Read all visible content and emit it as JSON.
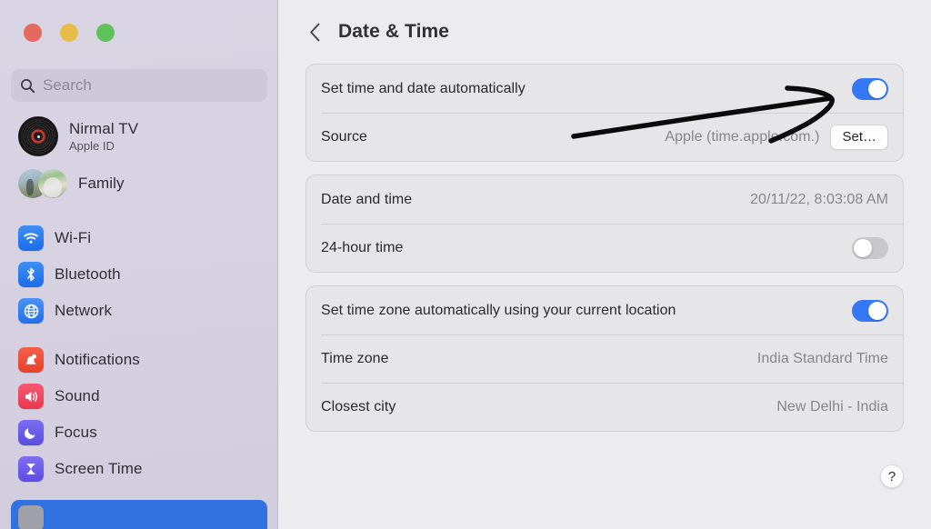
{
  "window": {
    "traffic_lights": [
      "close",
      "minimize",
      "maximize"
    ]
  },
  "sidebar": {
    "search": {
      "placeholder": "Search",
      "value": "",
      "icon": "search-icon"
    },
    "account": {
      "name": "Nirmal TV",
      "subtitle": "Apple ID",
      "avatar": "vinyl-record-avatar"
    },
    "family": {
      "label": "Family",
      "avatar": "family-photo-avatars"
    },
    "groups": [
      {
        "items": [
          {
            "label": "Wi-Fi",
            "icon": "wifi-icon",
            "color": "#2b7cf0"
          },
          {
            "label": "Bluetooth",
            "icon": "bluetooth-icon",
            "color": "#2b7cf0"
          },
          {
            "label": "Network",
            "icon": "globe-icon",
            "color": "#2b7cf0"
          }
        ]
      },
      {
        "items": [
          {
            "label": "Notifications",
            "icon": "bell-icon",
            "color": "#e8412c"
          },
          {
            "label": "Sound",
            "icon": "speaker-icon",
            "color": "#e8374f"
          },
          {
            "label": "Focus",
            "icon": "moon-icon",
            "color": "#5a4be0"
          },
          {
            "label": "Screen Time",
            "icon": "hourglass-icon",
            "color": "#5d4ce2"
          }
        ]
      }
    ],
    "selected_item": {
      "label": "",
      "icon": "general-icon",
      "highlight_color": "#2f72e0"
    }
  },
  "main": {
    "back_label": "‹",
    "title": "Date & Time",
    "cards": [
      {
        "rows": [
          {
            "title": "Set time and date automatically",
            "control": "toggle",
            "state": "on"
          },
          {
            "title": "Source",
            "value": "Apple (time.apple.com.)",
            "control": "button",
            "button_label": "Set…"
          }
        ]
      },
      {
        "rows": [
          {
            "title": "Date and time",
            "value": "20/11/22, 8:03:08 AM"
          },
          {
            "title": "24-hour time",
            "control": "toggle",
            "state": "off"
          }
        ]
      },
      {
        "rows": [
          {
            "title": "Set time zone automatically using your current location",
            "control": "toggle",
            "state": "on"
          },
          {
            "title": "Time zone",
            "value": "India Standard Time"
          },
          {
            "title": "Closest city",
            "value": "New Delhi - India"
          }
        ]
      }
    ],
    "help_label": "?"
  },
  "annotation": {
    "type": "hand-drawn-arrow",
    "color": "#0b0b0b",
    "points_to": "Set time and date automatically toggle"
  },
  "colors": {
    "sidebar_bg": "#d8d3e2",
    "content_bg": "#ececee",
    "card_bg": "#e6e6e8",
    "toggle_on": "#3478f6",
    "toggle_off": "#c8c8cc",
    "selection": "#2f72e0"
  }
}
